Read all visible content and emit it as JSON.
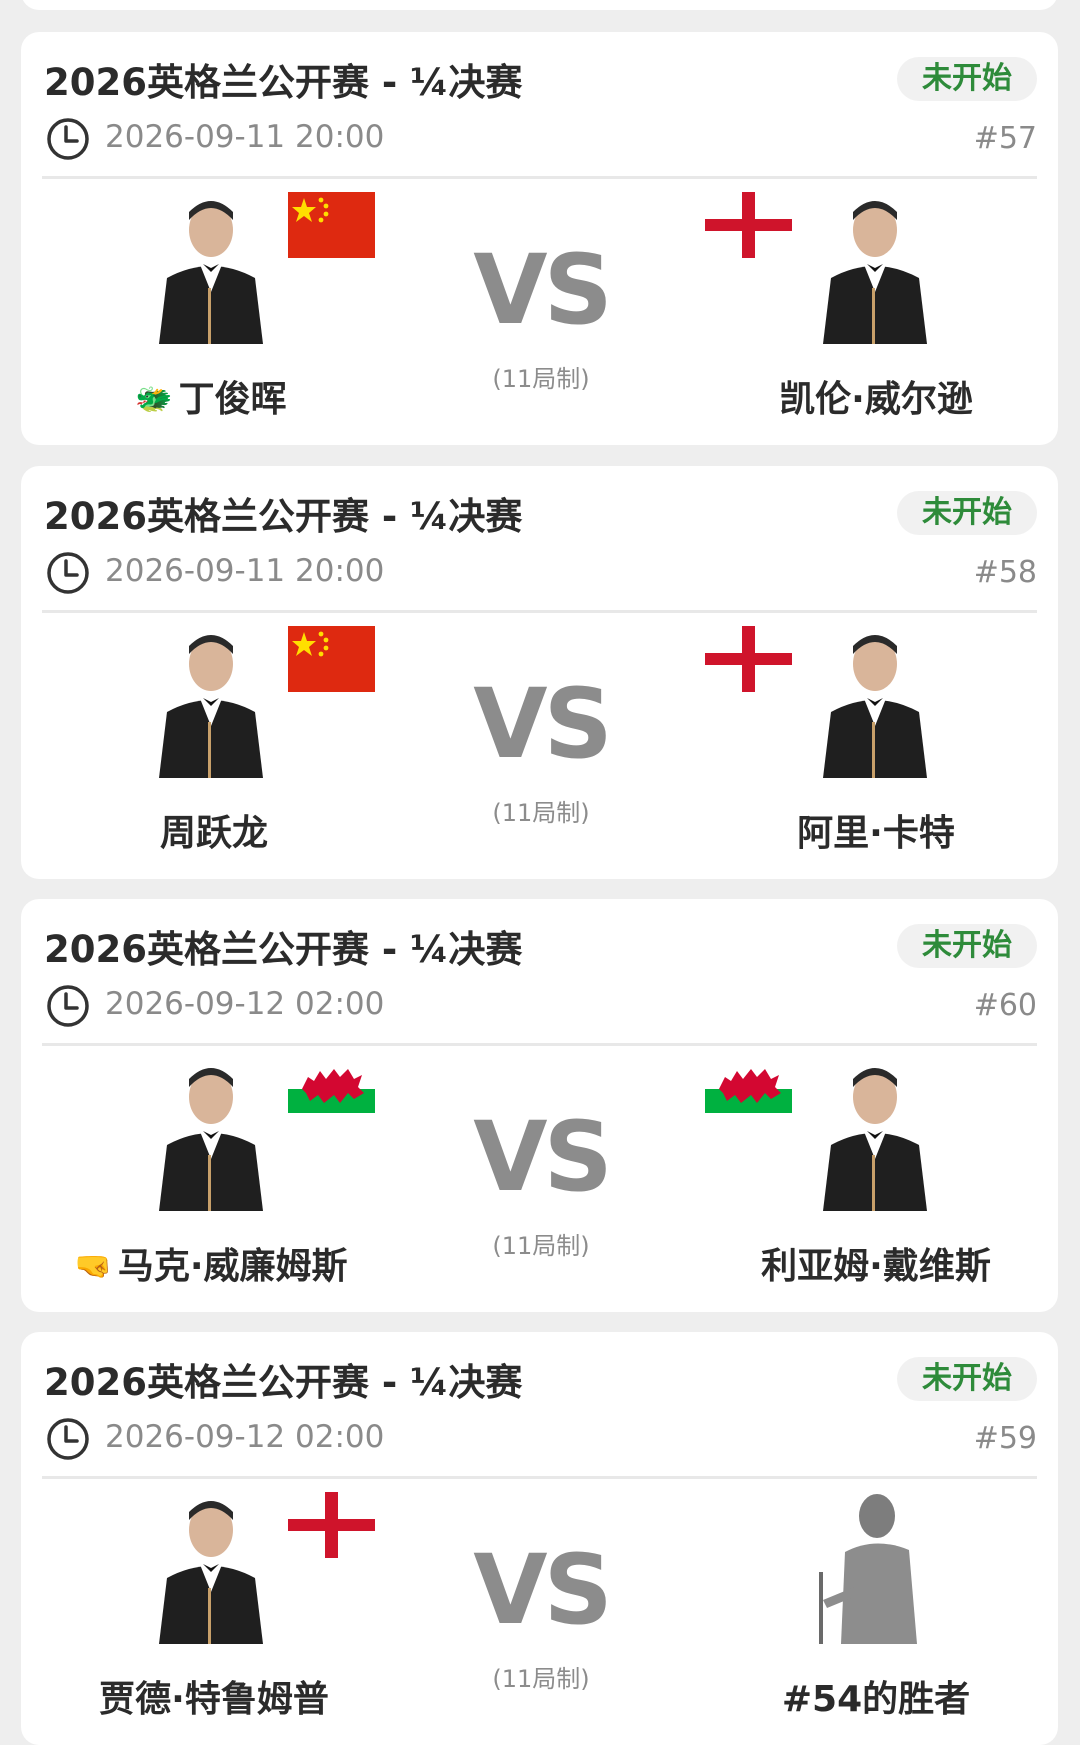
{
  "matches": [
    {
      "title": "2026英格兰公开赛 - ¼决赛",
      "status": "未开始",
      "datetime": "2026-09-11 20:00",
      "match_no": "#57",
      "vs": "VS",
      "format": "(11局制)",
      "left": {
        "name": "丁俊晖",
        "emoji": "🐲",
        "flag": "china",
        "portrait": "player-silhouette-icon"
      },
      "right": {
        "name": "凯伦·威尔逊",
        "emoji": "",
        "flag": "england",
        "portrait": "player-silhouette-icon"
      }
    },
    {
      "title": "2026英格兰公开赛 - ¼决赛",
      "status": "未开始",
      "datetime": "2026-09-11 20:00",
      "match_no": "#58",
      "vs": "VS",
      "format": "(11局制)",
      "left": {
        "name": "周跃龙",
        "emoji": "",
        "flag": "china",
        "portrait": "player-silhouette-icon"
      },
      "right": {
        "name": "阿里·卡特",
        "emoji": "",
        "flag": "england",
        "portrait": "player-silhouette-icon"
      }
    },
    {
      "title": "2026英格兰公开赛 - ¼决赛",
      "status": "未开始",
      "datetime": "2026-09-12 02:00",
      "match_no": "#60",
      "vs": "VS",
      "format": "(11局制)",
      "left": {
        "name": "马克·威廉姆斯",
        "emoji": "🤜",
        "flag": "wales",
        "portrait": "player-silhouette-icon"
      },
      "right": {
        "name": "利亚姆·戴维斯",
        "emoji": "",
        "flag": "wales",
        "portrait": "player-silhouette-icon"
      }
    },
    {
      "title": "2026英格兰公开赛 - ¼决赛",
      "status": "未开始",
      "datetime": "2026-09-12 02:00",
      "match_no": "#59",
      "vs": "VS",
      "format": "(11局制)",
      "left": {
        "name": "贾德·特鲁姆普",
        "emoji": "",
        "flag": "england",
        "portrait": "player-silhouette-icon"
      },
      "right": {
        "name": "#54的胜者",
        "emoji": "",
        "flag": "",
        "portrait": "placeholder-player-icon"
      }
    }
  ],
  "colors": {
    "status_green": "#2e8b3a",
    "china_red": "#de2910",
    "china_star": "#ffde00",
    "england_cross": "#cf142b",
    "wales_green": "#00b140",
    "wales_dragon": "#d30731",
    "vs_gray": "#8c8c8c"
  }
}
